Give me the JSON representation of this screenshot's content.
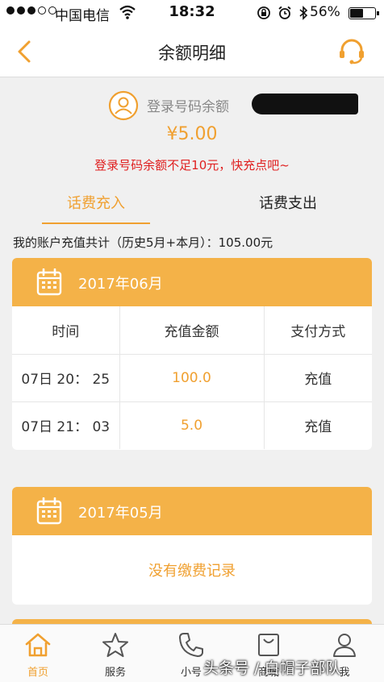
{
  "status_bar": {
    "carrier": "中国电信",
    "time": "18:32",
    "battery_percent": "56%",
    "battery_level": 0.56
  },
  "header": {
    "title": "余额明细",
    "back_icon": "chevron-left-icon",
    "service_icon": "headset-icon"
  },
  "balance": {
    "label": "登录号码余额",
    "amount": "¥5.00",
    "warning": "登录号码余额不足10元，快充点吧~"
  },
  "tabs": [
    {
      "label": "话费充入",
      "active": true
    },
    {
      "label": "话费支出",
      "active": false
    }
  ],
  "summary": {
    "text": "我的账户充值共计（历史5月+本月）：",
    "value": "105.00元"
  },
  "months": [
    {
      "title": "2017年06月",
      "columns": [
        "时间",
        "充值金额",
        "支付方式"
      ],
      "rows": [
        {
          "time": "07日 20： 25",
          "amount": "100.0",
          "method": "充值"
        },
        {
          "time": "07日 21： 03",
          "amount": "5.0",
          "method": "充值"
        }
      ]
    },
    {
      "title": "2017年05月",
      "empty_text": "没有缴费记录"
    }
  ],
  "tabbar": [
    {
      "label": "首页",
      "icon": "home-icon",
      "active": true
    },
    {
      "label": "服务",
      "icon": "star-icon",
      "active": false
    },
    {
      "label": "小号",
      "icon": "phone-icon",
      "active": false
    },
    {
      "label": "商城",
      "icon": "shopping-bag-icon",
      "active": false
    },
    {
      "label": "我",
      "icon": "user-icon",
      "active": false
    }
  ],
  "watermark": "头条号 / 白帽子部队",
  "colors": {
    "accent": "#f0a030",
    "header_bg": "#f4b248",
    "warning": "#e02020"
  }
}
